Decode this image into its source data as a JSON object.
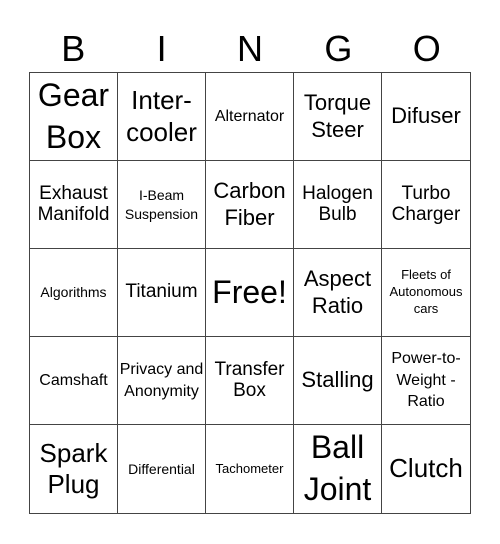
{
  "header": {
    "letters": [
      "B",
      "I",
      "N",
      "G",
      "O"
    ]
  },
  "cells": [
    {
      "text": "Gear Box",
      "size": "s-xl"
    },
    {
      "text": "Inter-cooler",
      "size": "s-l"
    },
    {
      "text": "Alternator",
      "size": "s-s"
    },
    {
      "text": "Torque Steer",
      "size": "s-m"
    },
    {
      "text": "Difuser",
      "size": "s-m"
    },
    {
      "text": "Exhaust Manifold",
      "size": "s-ms"
    },
    {
      "text": "I-Beam Suspension",
      "size": "s-xs"
    },
    {
      "text": "Carbon Fiber",
      "size": "s-m"
    },
    {
      "text": "Halogen Bulb",
      "size": "s-ms"
    },
    {
      "text": "Turbo Charger",
      "size": "s-ms"
    },
    {
      "text": "Algorithms",
      "size": "s-xs"
    },
    {
      "text": "Titanium",
      "size": "s-ms"
    },
    {
      "text": "Free!",
      "size": "s-xl"
    },
    {
      "text": "Aspect Ratio",
      "size": "s-m"
    },
    {
      "text": "Fleets of Autonomous cars",
      "size": "s-xxs"
    },
    {
      "text": "Camshaft",
      "size": "s-s"
    },
    {
      "text": "Privacy and Anonymity",
      "size": "s-s"
    },
    {
      "text": "Transfer Box",
      "size": "s-ms"
    },
    {
      "text": "Stalling",
      "size": "s-m"
    },
    {
      "text": "Power-to-Weight - Ratio",
      "size": "s-s"
    },
    {
      "text": "Spark Plug",
      "size": "s-l"
    },
    {
      "text": "Differential",
      "size": "s-xs"
    },
    {
      "text": "Tachometer",
      "size": "s-xxs"
    },
    {
      "text": "Ball Joint",
      "size": "s-xl"
    },
    {
      "text": "Clutch",
      "size": "s-l"
    }
  ]
}
